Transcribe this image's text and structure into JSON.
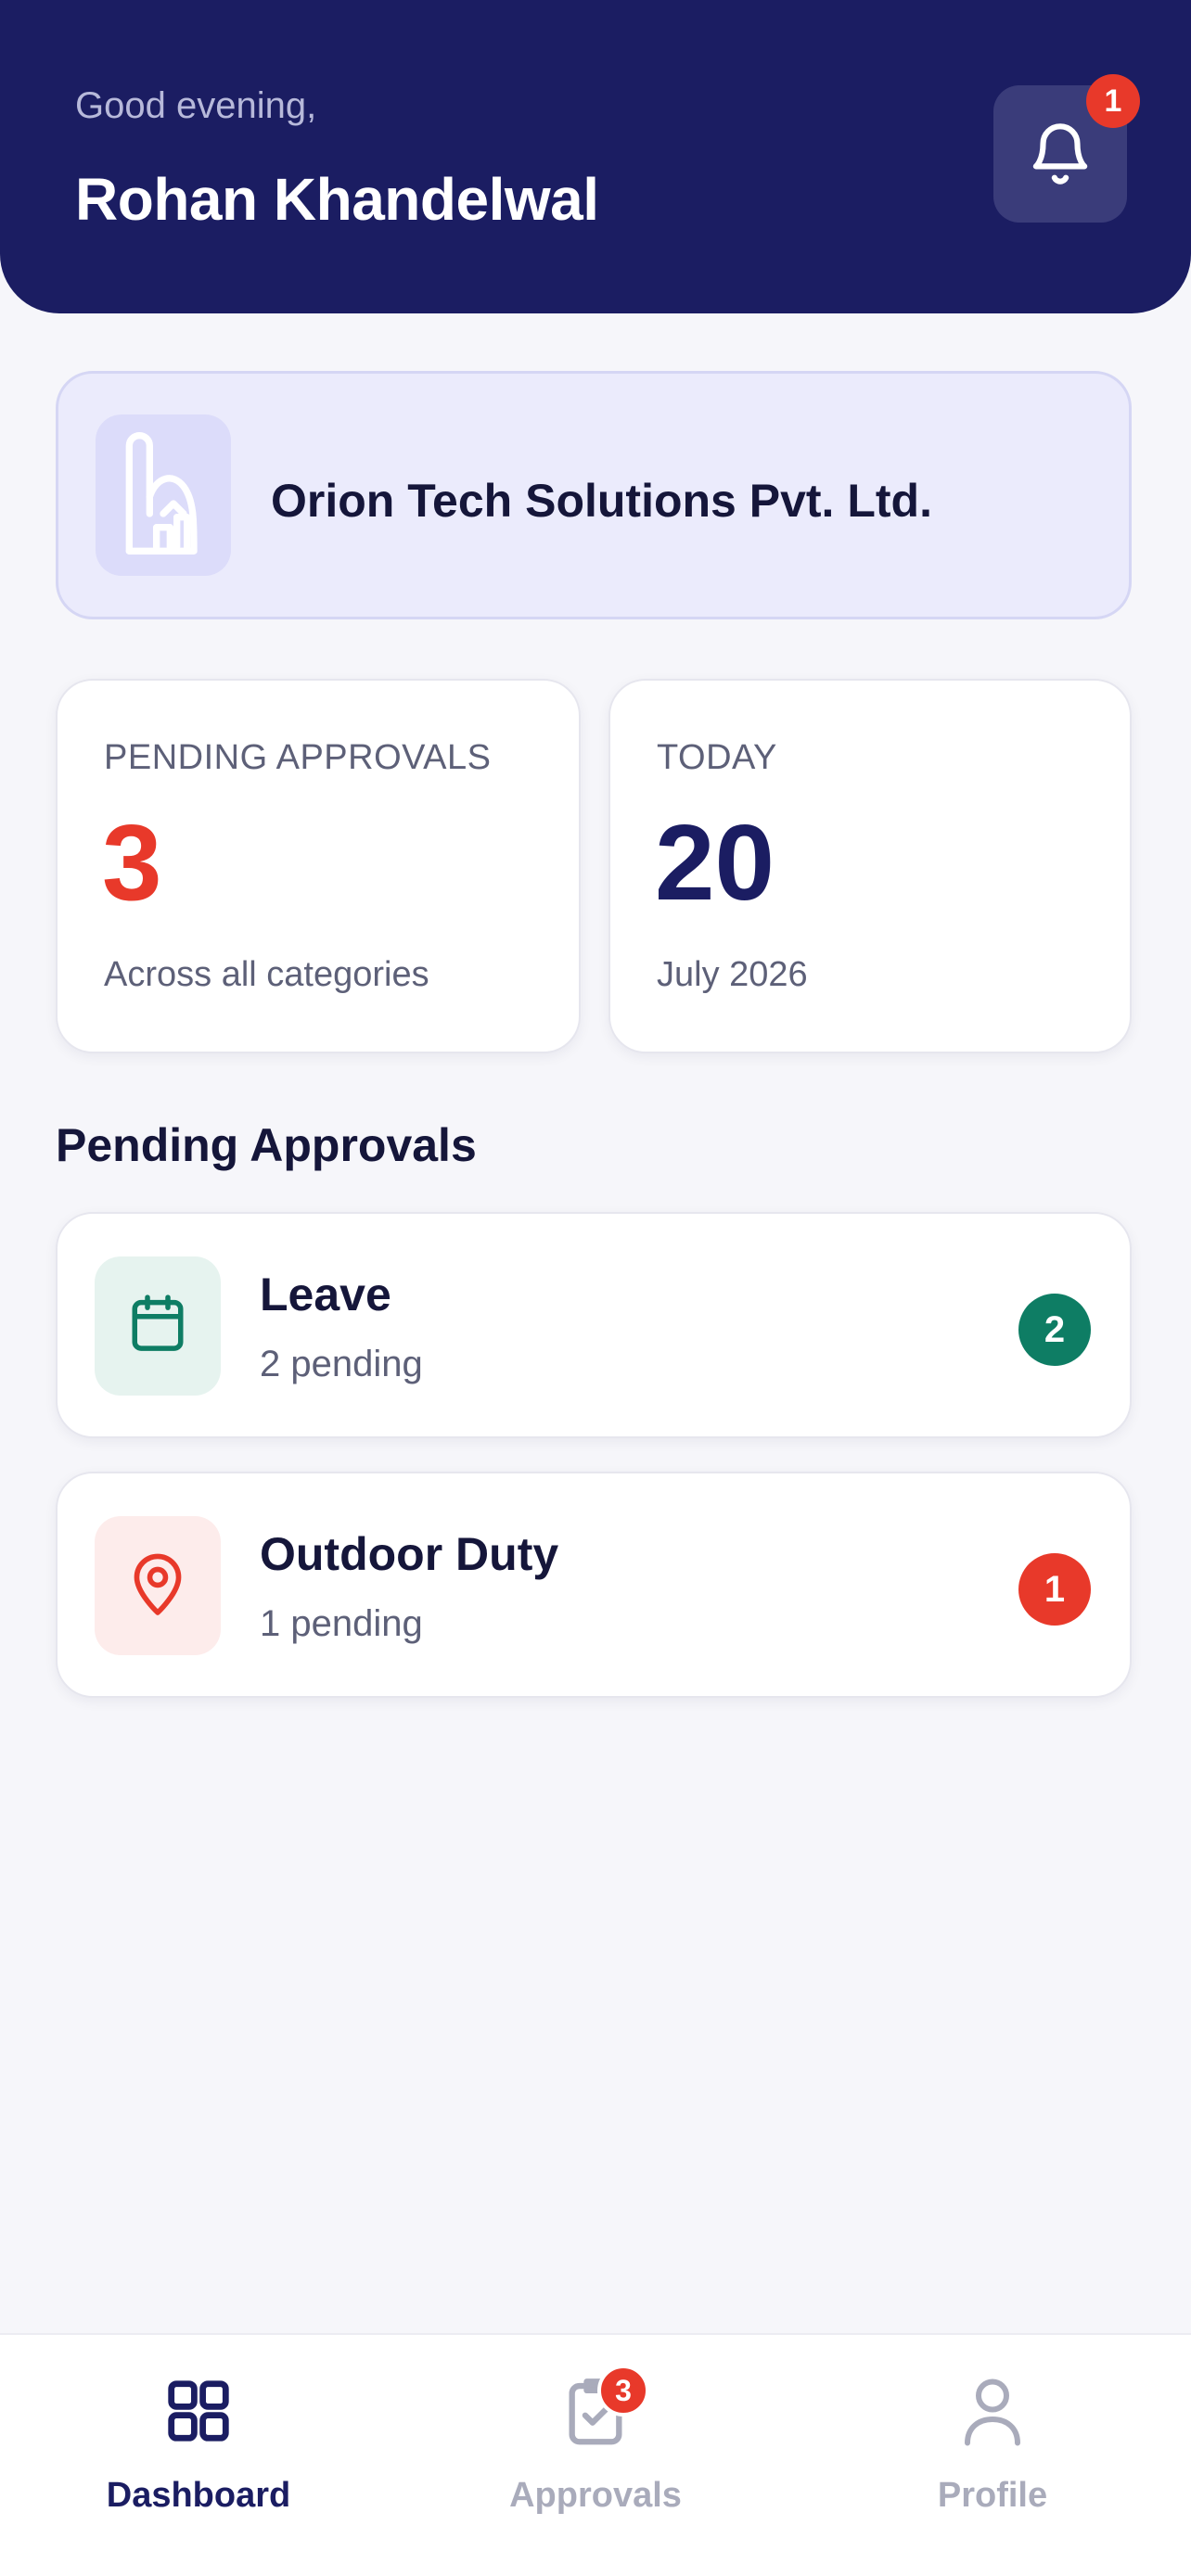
{
  "header": {
    "greeting": "Good evening,",
    "user_name": "Rohan Khandelwal",
    "notification_count": "1",
    "bg_color": "#1b1d62"
  },
  "company": {
    "name": "Orion Tech Solutions Pvt. Ltd.",
    "logo_icon": "building-logo-icon"
  },
  "stats": {
    "pending": {
      "label": "PENDING APPROVALS",
      "value": "3",
      "subtitle": "Across all categories",
      "color": "#e8392a"
    },
    "today": {
      "label": "TODAY",
      "value": "20",
      "subtitle": "July 2026",
      "color": "#1b1d62"
    }
  },
  "section": {
    "title": "Pending Approvals"
  },
  "approvals": [
    {
      "title": "Leave",
      "subtitle": "2 pending",
      "count": "2",
      "icon": "calendar-icon",
      "color": "#0e7d64"
    },
    {
      "title": "Outdoor Duty",
      "subtitle": "1 pending",
      "count": "1",
      "icon": "location-pin-icon",
      "color": "#e8392a"
    }
  ],
  "nav": {
    "dashboard": {
      "label": "Dashboard",
      "icon": "grid-icon",
      "active": true
    },
    "approvals": {
      "label": "Approvals",
      "icon": "clipboard-check-icon",
      "badge": "3",
      "active": false
    },
    "profile": {
      "label": "Profile",
      "icon": "user-icon",
      "active": false
    }
  }
}
